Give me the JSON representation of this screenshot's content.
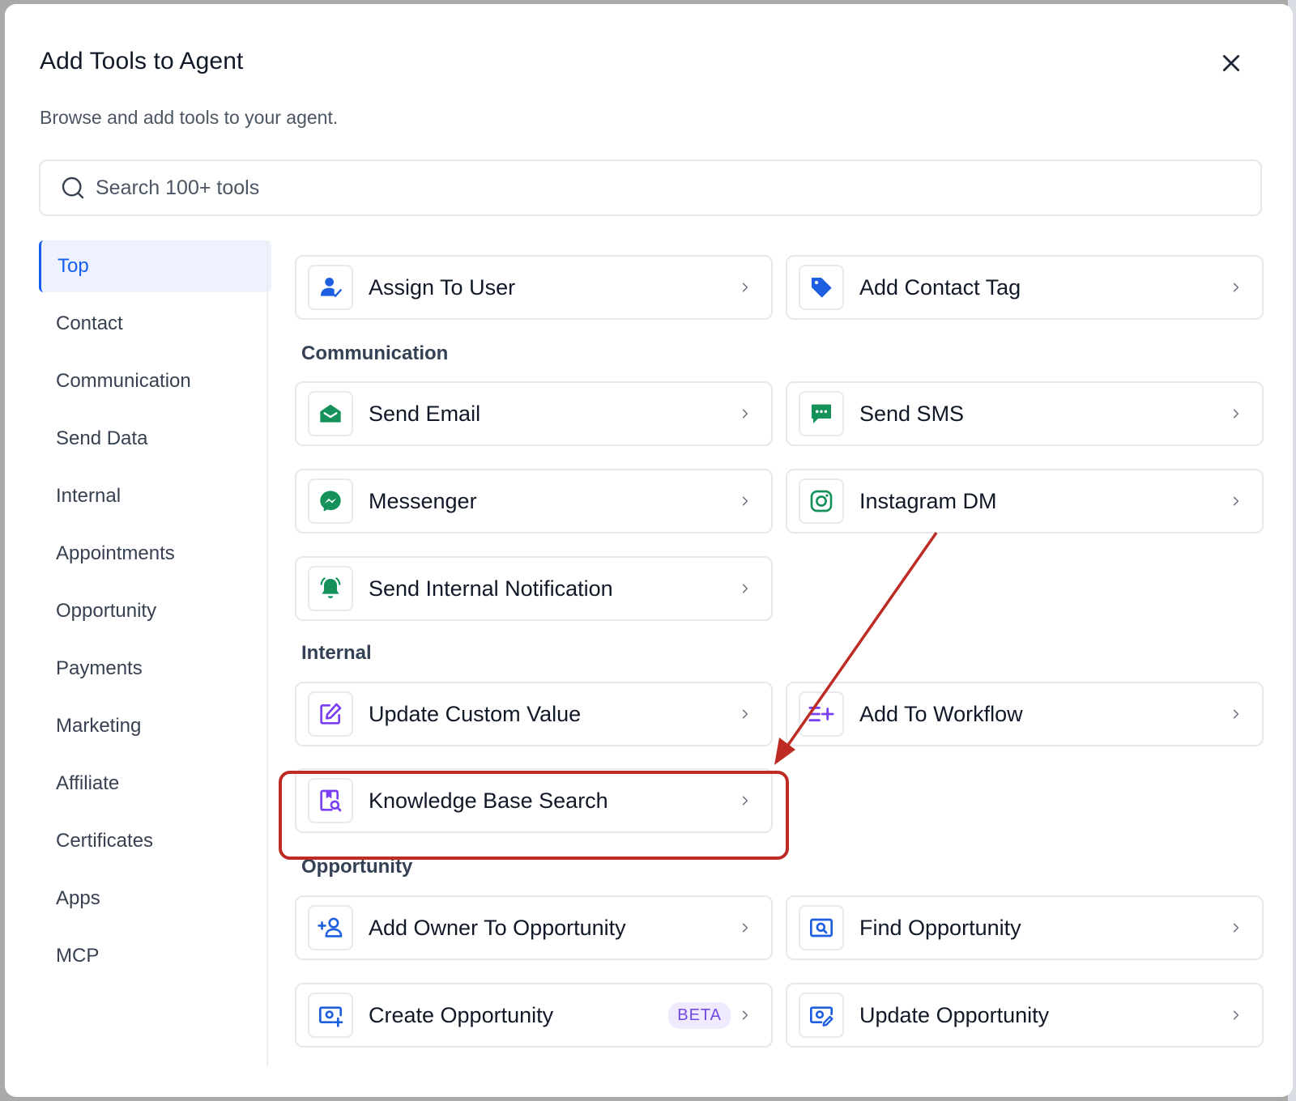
{
  "dialog": {
    "title": "Add Tools to Agent",
    "subtitle": "Browse and add tools to your agent.",
    "search_placeholder": "Search 100+ tools"
  },
  "sidebar": {
    "items": [
      {
        "label": "Top",
        "active": true
      },
      {
        "label": "Contact"
      },
      {
        "label": "Communication"
      },
      {
        "label": "Send Data"
      },
      {
        "label": "Internal"
      },
      {
        "label": "Appointments"
      },
      {
        "label": "Opportunity"
      },
      {
        "label": "Payments"
      },
      {
        "label": "Marketing"
      },
      {
        "label": "Affiliate"
      },
      {
        "label": "Certificates"
      },
      {
        "label": "Apps"
      },
      {
        "label": "MCP"
      }
    ]
  },
  "sections": {
    "top": {
      "tools": [
        {
          "label": "Assign To User",
          "icon": "assign-user-icon"
        },
        {
          "label": "Add Contact Tag",
          "icon": "tag-icon"
        }
      ]
    },
    "communication": {
      "heading": "Communication",
      "tools": [
        {
          "label": "Send Email",
          "icon": "email-icon"
        },
        {
          "label": "Send SMS",
          "icon": "sms-icon"
        },
        {
          "label": "Messenger",
          "icon": "messenger-icon"
        },
        {
          "label": "Instagram DM",
          "icon": "instagram-icon"
        },
        {
          "label": "Send Internal Notification",
          "icon": "bell-icon"
        }
      ]
    },
    "internal": {
      "heading": "Internal",
      "tools": [
        {
          "label": "Update Custom Value",
          "icon": "edit-icon"
        },
        {
          "label": "Add To Workflow",
          "icon": "workflow-add-icon"
        },
        {
          "label": "Knowledge Base Search",
          "icon": "knowledge-search-icon",
          "highlighted": true
        }
      ]
    },
    "opportunity": {
      "heading": "Opportunity",
      "tools": [
        {
          "label": "Add Owner To Opportunity",
          "icon": "add-owner-icon"
        },
        {
          "label": "Find Opportunity",
          "icon": "find-icon"
        },
        {
          "label": "Create Opportunity",
          "icon": "create-opportunity-icon",
          "badge": "BETA"
        },
        {
          "label": "Update Opportunity",
          "icon": "update-opportunity-icon"
        }
      ]
    }
  },
  "colors": {
    "accent": "#155eef",
    "blue_icon": "#1d5fe0",
    "green_icon": "#15925a",
    "purple_icon": "#7a3ff2",
    "annotation_red": "#bd2b24"
  }
}
